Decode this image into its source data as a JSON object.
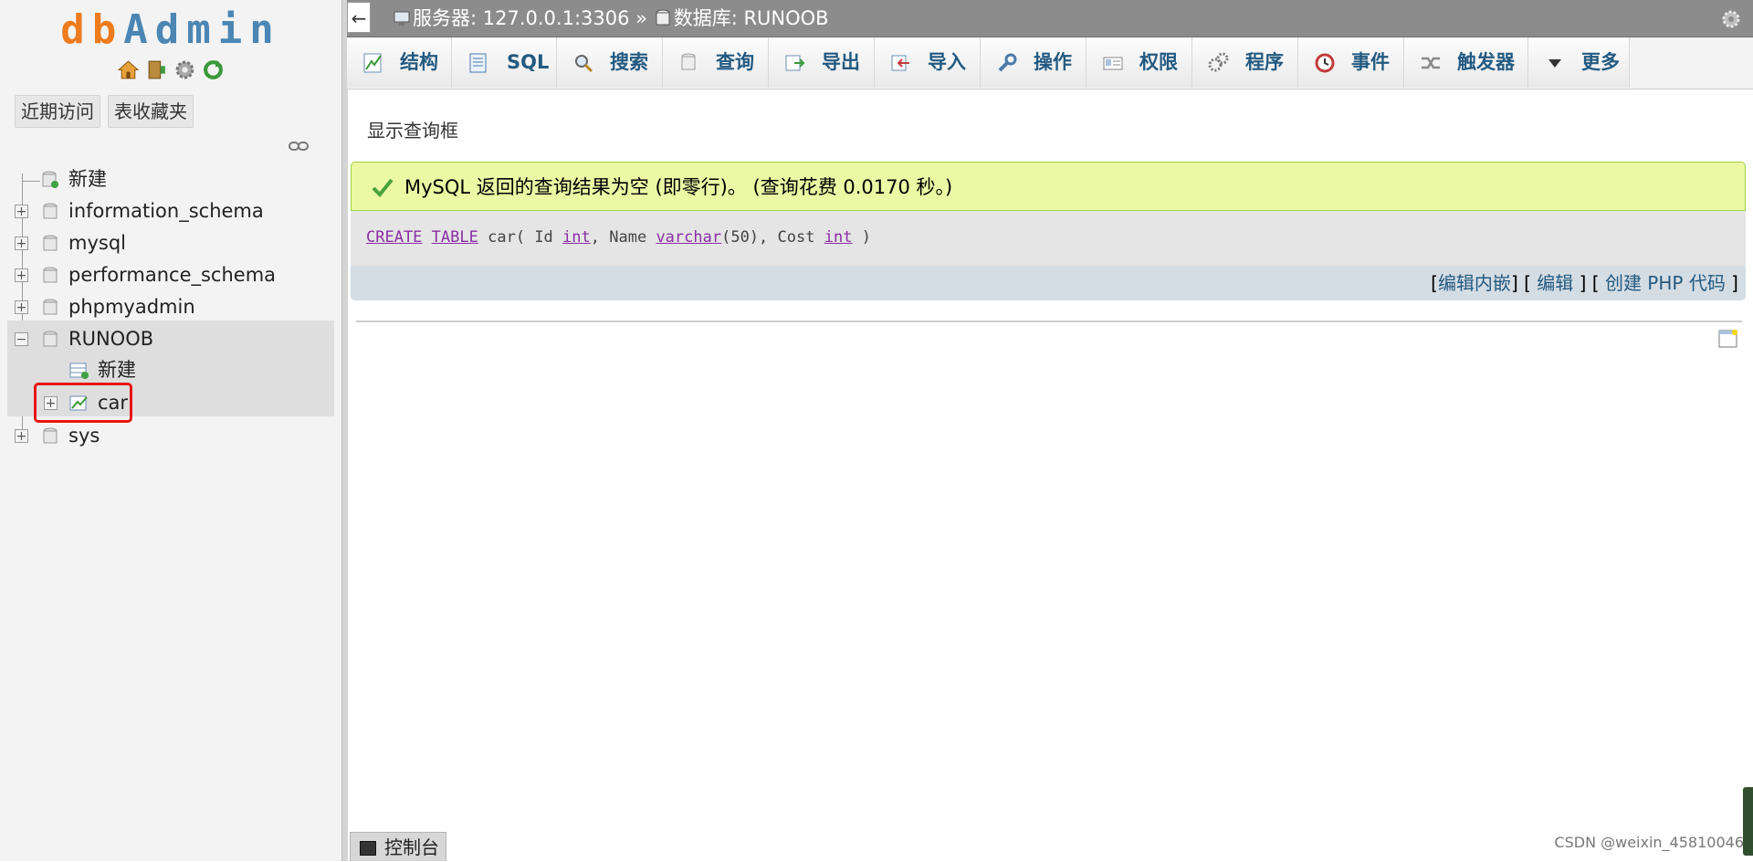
{
  "nav": {
    "logo": {
      "part1": "db",
      "part2": "Admin"
    },
    "logo_icons": [
      "home-icon",
      "database-exit-icon",
      "gear-icon",
      "refresh-icon"
    ],
    "tabs": [
      "近期访问",
      "表收藏夹"
    ],
    "tree": {
      "new_label": "新建",
      "databases": [
        "information_schema",
        "mysql",
        "performance_schema",
        "phpmyadmin",
        "RUNOOB",
        "sys"
      ],
      "runoob_children": {
        "new_label": "新建",
        "table": "car"
      }
    }
  },
  "topbar": {
    "back": "←",
    "server": "服务器: 127.0.0.1:3306",
    "separator": "»",
    "database": "数据库: RUNOOB"
  },
  "tabs": [
    "结构",
    "SQL",
    "搜索",
    "查询",
    "导出",
    "导入",
    "操作",
    "权限",
    "程序",
    "事件",
    "触发器",
    "更多"
  ],
  "main": {
    "show_query": "显示查询框",
    "success_message": "MySQL 返回的查询结果为空 (即零行)。 (查询花费 0.0170 秒。)",
    "sql": {
      "create": "CREATE",
      "table": "TABLE",
      "name": "car(",
      "col1": "Id",
      "type1": "int",
      "col2": ", Name",
      "type2": "varchar",
      "len": "(50)",
      "col3": ", Cost",
      "type3": "int",
      "close": ")"
    },
    "actions": {
      "edit_inline": "编辑内嵌",
      "edit": "编辑",
      "create_php": "创建 PHP 代码"
    }
  },
  "console": {
    "label": "控制台"
  },
  "watermark": "CSDN @weixin_45810046",
  "colors": {
    "accent": "#235a81",
    "success_bg": "#ebf8a4",
    "highlight": "#e8160f"
  }
}
